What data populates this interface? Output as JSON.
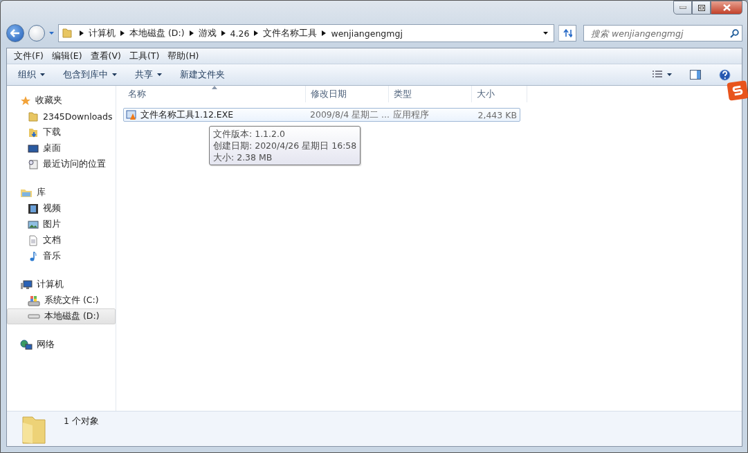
{
  "address_bar": {
    "breadcrumbs": [
      "计算机",
      "本地磁盘 (D:)",
      "游戏",
      "4.26",
      "文件名称工具",
      "wenjiangengmgj"
    ]
  },
  "search": {
    "placeholder": "搜索 wenjiangengmgj"
  },
  "menu": [
    "文件(F)",
    "编辑(E)",
    "查看(V)",
    "工具(T)",
    "帮助(H)"
  ],
  "toolbar": [
    {
      "label": "组织",
      "dropdown": true
    },
    {
      "label": "包含到库中",
      "dropdown": true
    },
    {
      "label": "共享",
      "dropdown": true
    },
    {
      "label": "新建文件夹",
      "dropdown": false
    }
  ],
  "sidebar": {
    "groups": [
      {
        "label": "收藏夹",
        "kind": "star",
        "children": [
          {
            "label": "2345Downloads",
            "kind": "folder",
            "selected": false
          },
          {
            "label": "下载",
            "kind": "download",
            "selected": false
          },
          {
            "label": "桌面",
            "kind": "desktop",
            "selected": false
          },
          {
            "label": "最近访问的位置",
            "kind": "recent",
            "selected": false
          }
        ]
      },
      {
        "label": "库",
        "kind": "library",
        "children": [
          {
            "label": "视频",
            "kind": "video",
            "selected": false
          },
          {
            "label": "图片",
            "kind": "picture",
            "selected": false
          },
          {
            "label": "文档",
            "kind": "document",
            "selected": false
          },
          {
            "label": "音乐",
            "kind": "music",
            "selected": false
          }
        ]
      },
      {
        "label": "计算机",
        "kind": "computer",
        "children": [
          {
            "label": "系统文件 (C:)",
            "kind": "system-drive",
            "selected": false
          },
          {
            "label": "本地磁盘 (D:)",
            "kind": "drive",
            "selected": true
          }
        ]
      },
      {
        "label": "网络",
        "kind": "network"
      }
    ]
  },
  "table": {
    "columns": [
      {
        "label": "名称",
        "sorted": true
      },
      {
        "label": "修改日期",
        "sorted": false
      },
      {
        "label": "类型",
        "sorted": false
      },
      {
        "label": "大小",
        "sorted": false
      }
    ],
    "rows": [
      {
        "name": "文件名称工具1.12.EXE",
        "modified": "2009/8/4 星期二 ...",
        "type": "应用程序",
        "size": "2,443 KB",
        "hovered": true
      }
    ]
  },
  "tooltip": {
    "lines": [
      "文件版本: 1.1.2.0",
      "创建日期: 2020/4/26 星期日 16:58",
      "大小: 2.38 MB"
    ]
  },
  "status_bar": {
    "text": "1 个对象"
  }
}
